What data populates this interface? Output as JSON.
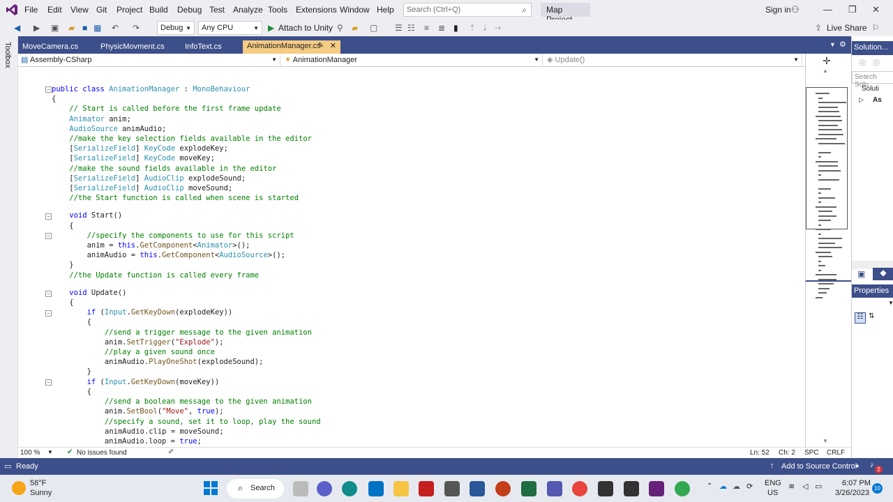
{
  "menubar": {
    "items": [
      "File",
      "Edit",
      "View",
      "Git",
      "Project",
      "Build",
      "Debug",
      "Test",
      "Analyze",
      "Tools",
      "Extensions",
      "Window",
      "Help"
    ],
    "search_placeholder": "Search (Ctrl+Q)",
    "project_name": "Map Project",
    "sign_in": "Sign in"
  },
  "toolbar": {
    "config": "Debug",
    "platform": "Any CPU",
    "attach": "Attach to Unity",
    "live_share": "Live Share"
  },
  "toolbox_label": "Toolbox",
  "tabs": [
    "MoveCamera.cs",
    "PhysicMovment.cs",
    "InfoText.cs",
    "AnimationManager.cs"
  ],
  "navbar": {
    "project": "Assembly-CSharp",
    "class": "AnimationManager",
    "member": "Update()"
  },
  "code": {
    "l1": "public class AnimationManager : MonoBehaviour",
    "l2": "{",
    "l3": "// Start is called before the first frame update",
    "l4a": "Animator",
    "l4b": " anim;",
    "l5a": "AudioSource",
    "l5b": " animAudio;",
    "l6": "//make the key selection fields available in the editor",
    "l7a": "SerializeField",
    "l7b": "KeyCode",
    "l7c": " explodeKey;",
    "l8a": "SerializeField",
    "l8b": "KeyCode",
    "l8c": " moveKey;",
    "l9": "//make the sound fields available in the editor",
    "l10a": "SerializeField",
    "l10b": "AudioClip",
    "l10c": " explodeSound;",
    "l11a": "SerializeField",
    "l11b": "AudioClip",
    "l11c": " moveSound;",
    "l12": "//the Start function is called when scene is started",
    "l13a": "void",
    "l13b": " Start()",
    "l14": "{",
    "l15": "//specify the components to use for this script",
    "l16": "anim = this.GetComponent<Animator>();",
    "l17": "animAudio = this.GetComponent<AudioSource>();",
    "l18": "}",
    "l19": "//the Update function is called every frame",
    "l20a": "void",
    "l20b": " Update()",
    "l21": "{",
    "l22": "if (Input.GetKeyDown(explodeKey))",
    "l23": "{",
    "l24": "//send a trigger message to the given animation",
    "l25": "anim.SetTrigger(\"Explode\");",
    "l26": "//play a given sound once",
    "l27": "animAudio.PlayOneShot(explodeSound);",
    "l28": "}",
    "l29": "if (Input.GetKeyDown(moveKey))",
    "l30": "{",
    "l31": "//send a boolean message to the given animation",
    "l32": "anim.SetBool(\"Move\", true);",
    "l33": "//specify a sound, set it to loop, play the sound",
    "l34": "animAudio.clip = moveSound;",
    "l35": "animAudio.loop = true;"
  },
  "editor_status": {
    "zoom": "100 %",
    "issues": "No issues found",
    "ln": "Ln: 52",
    "ch": "Ch: 2",
    "spc": "SPC",
    "crlf": "CRLF"
  },
  "solution_panel": {
    "title": "Solution...",
    "search": "Search Solu",
    "item1": "Soluti",
    "item2": "As",
    "properties": "Properties"
  },
  "status_bar": {
    "ready": "Ready",
    "source_control": "Add to Source Control",
    "notif_count": "2"
  },
  "taskbar": {
    "weather_temp": "58°F",
    "weather_desc": "Sunny",
    "search": "Search",
    "lang1": "ENG",
    "lang2": "US",
    "time": "6:07 PM",
    "date": "3/26/2023",
    "notif": "10"
  }
}
